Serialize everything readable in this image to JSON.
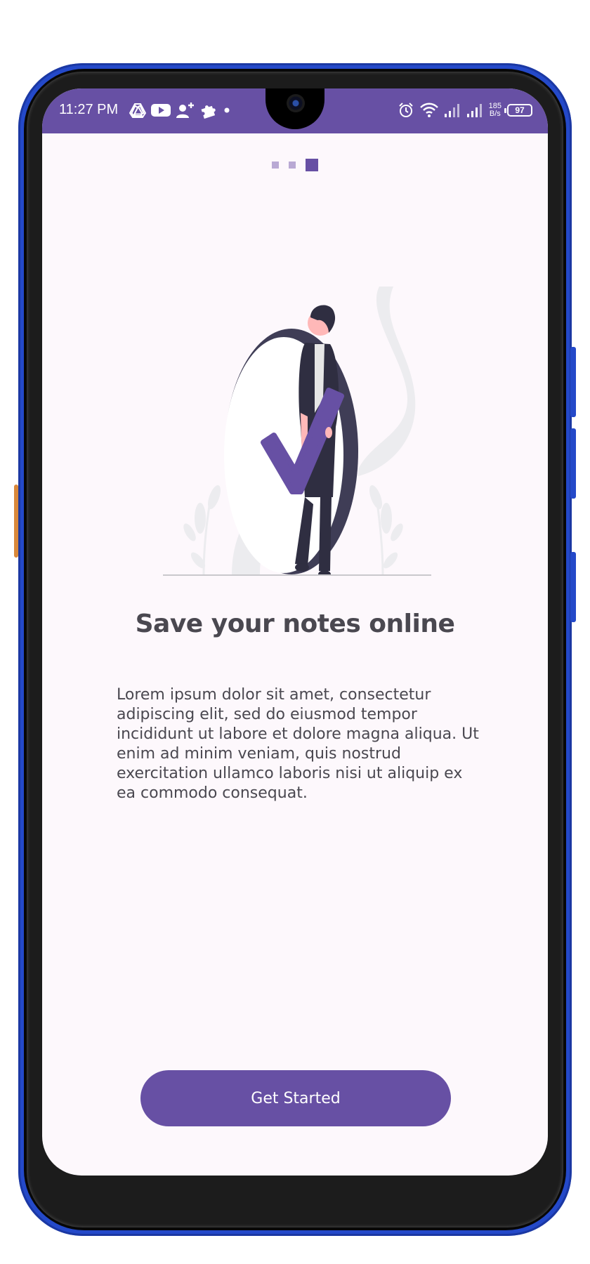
{
  "status_bar": {
    "time": "11:27 PM",
    "net_speed_value": "185",
    "net_speed_unit": "B/s",
    "battery": "97",
    "icons_left": [
      "drive-icon",
      "youtube-icon",
      "add-person-icon",
      "puzzle-icon",
      "dot-icon"
    ],
    "icons_right": [
      "alarm-icon",
      "wifi-icon",
      "signal-icon",
      "signal-icon"
    ]
  },
  "pager": {
    "pages": 3,
    "active_index": 2
  },
  "onboarding": {
    "illustration": "person-with-checkmark-illustration",
    "title": "Save your notes online",
    "body": "Lorem ipsum dolor sit amet, consectetur adipiscing elit, sed do eiusmod tempor incididunt ut labore et dolore magna aliqua. Ut enim ad minim veniam, quis nostrud exercitation ullamco laboris nisi ut aliquip ex ea commodo consequat.",
    "cta_label": "Get Started"
  },
  "colors": {
    "primary": "#6750a4",
    "background": "#fdf8fc",
    "text": "#4a4850",
    "dot_inactive": "#b9a9d4",
    "frame": "#2449c9"
  }
}
